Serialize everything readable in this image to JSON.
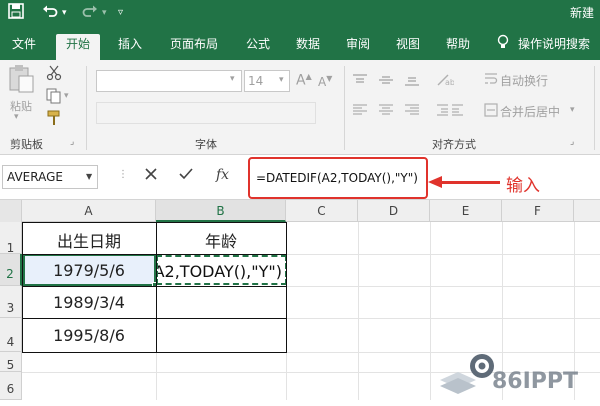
{
  "titlebar": {
    "save_icon": "save-icon",
    "undo_icon": "undo-icon",
    "redo_icon": "redo-icon",
    "doc_title": "新建"
  },
  "ribbon_tabs": [
    "文件",
    "开始",
    "插入",
    "页面布局",
    "公式",
    "数据",
    "审阅",
    "视图",
    "帮助"
  ],
  "tell_me": "操作说明搜索",
  "ribbon": {
    "paste_label": "粘贴",
    "font_size": "14",
    "wrap_text": "自动换行",
    "merge_center": "合并后居中",
    "groups": {
      "clipboard": "剪贴板",
      "font": "字体",
      "alignment": "对齐方式"
    }
  },
  "formula_bar": {
    "name_box": "AVERAGE",
    "cancel_icon": "cancel-icon",
    "enter_icon": "check-icon",
    "fx_label": "fx",
    "formula": "=DATEDIF(A2,TODAY(),\"Y\")"
  },
  "annotation": {
    "callout": "输入",
    "color": "#e0332c"
  },
  "sheet": {
    "columns": [
      "A",
      "B",
      "C",
      "D",
      "E",
      "F"
    ],
    "rows": [
      "1",
      "2",
      "3",
      "4",
      "5",
      "6"
    ],
    "header_a": "出生日期",
    "header_b": "年龄",
    "dates": [
      "1979/5/6",
      "1989/3/4",
      "1995/8/6"
    ],
    "editing_text": "A2,TODAY(),\"Y\")"
  },
  "watermark": "86IPPT",
  "colors": {
    "accent": "#217346",
    "selected_cell_bg": "#e8f0fb"
  }
}
